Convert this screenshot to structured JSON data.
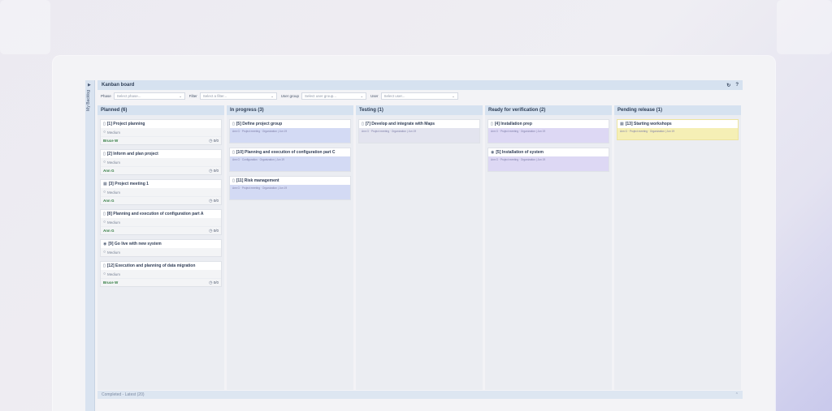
{
  "window": {
    "title": "Kanban board"
  },
  "sidebar": {
    "label": "My Backlog"
  },
  "header": {
    "refresh_icon": "refresh-icon",
    "help_label": "?"
  },
  "filters": {
    "phase_label": "Phase",
    "phase_placeholder": "Select phase...",
    "filter_label": "Filter",
    "filter_placeholder": "Select a filter...",
    "usergroup_label": "User group",
    "usergroup_placeholder": "Select user group...",
    "user_label": "User",
    "user_placeholder": "Select user..."
  },
  "columns": [
    {
      "title": "Planned (6)",
      "cards": [
        {
          "title": "[1] Project planning",
          "priority": "Medium",
          "user": "Bruce W",
          "count": "0/0"
        },
        {
          "title": "[2] Inform and plan project",
          "priority": "Medium",
          "user": "Ann G",
          "count": "0/0"
        },
        {
          "title": "[3] Project meeting 1",
          "priority": "Medium",
          "user": "Ann G",
          "count": "0/0"
        },
        {
          "title": "[8] Planning and execution of configuration part A",
          "priority": "Medium",
          "user": "Ann G",
          "count": "0/0"
        },
        {
          "title": "[9] Go live with new system",
          "priority": "Medium",
          "user": "",
          "count": ""
        },
        {
          "title": "[12] Execution and planning of data migration",
          "priority": "Medium",
          "user": "Bruce W",
          "count": "0/0"
        }
      ]
    },
    {
      "title": "In progress (3)",
      "cards": [
        {
          "title": "[5] Define project group",
          "strip": "Ann G · Project meeting · Organization | Jun 19"
        },
        {
          "title": "[10] Planning and execution of configuration part C",
          "strip": "Ann G · Configuration · Organization | Jun 19"
        },
        {
          "title": "[11] Risk management",
          "strip": "Ann G · Project meeting · Organization | Jun 19"
        }
      ]
    },
    {
      "title": "Testing (1)",
      "cards": [
        {
          "title": "[7] Develop and integrate with Maps",
          "strip": "Ann G · Project meeting · Organization | Jun 19"
        }
      ]
    },
    {
      "title": "Ready for verification (2)",
      "cards": [
        {
          "title": "[4] Installation prep",
          "strip": "Ann G · Project meeting · Organization | Jun 19"
        },
        {
          "title": "[5] Installation of system",
          "strip": "Ann G · Project meeting · Organization | Jun 19"
        }
      ]
    },
    {
      "title": "Pending release (1)",
      "cards": [
        {
          "title": "[13] Starting workshops",
          "strip": "Ann G · Project meeting · Organization | Jun 19"
        }
      ]
    }
  ],
  "footer": {
    "label": "Completed - Latest (20)"
  },
  "colors": {
    "header_blue": "#d6e2f0",
    "strip_blue": "#d3daf4",
    "strip_grey": "#e3e4ef",
    "strip_purple": "#ddd8f4",
    "strip_yellow": "#f5efb5",
    "user_green": "#2f7a3e"
  }
}
